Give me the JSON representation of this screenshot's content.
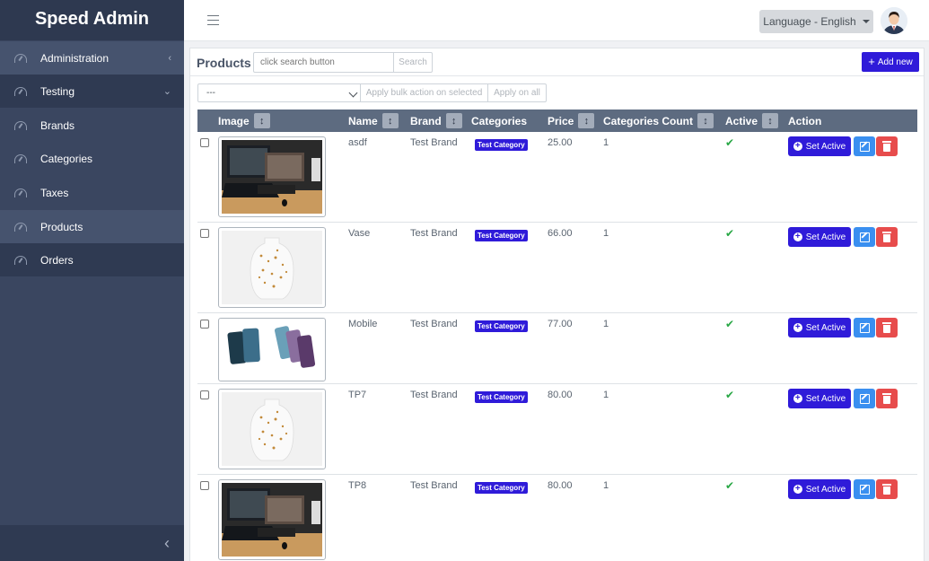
{
  "app": {
    "brand": "Speed Admin"
  },
  "sidebar": {
    "items": [
      {
        "label": "Administration",
        "icon": "dashboard-icon",
        "chevron": "‹"
      },
      {
        "label": "Testing",
        "icon": "dashboard-icon",
        "chevron": "⌄"
      },
      {
        "label": "Brands",
        "icon": "dashboard-icon"
      },
      {
        "label": "Categories",
        "icon": "dashboard-icon"
      },
      {
        "label": "Taxes",
        "icon": "dashboard-icon"
      },
      {
        "label": "Products",
        "icon": "dashboard-icon"
      },
      {
        "label": "Orders",
        "icon": "dashboard-icon"
      }
    ],
    "collapse_glyph": "‹"
  },
  "topbar": {
    "language_label": "Language - English"
  },
  "products": {
    "title": "Products",
    "search_placeholder": "click search button",
    "search_button": "Search",
    "add_button": "Add new",
    "bulk_select_value": "---",
    "bulk_apply": "Apply bulk action on selected",
    "bulk_apply_all": "Apply on all",
    "columns": {
      "image": "Image",
      "name": "Name",
      "brand": "Brand",
      "categories": "Categories",
      "price": "Price",
      "categories_count": "Categories Count",
      "active": "Active",
      "action": "Action"
    },
    "sort_glyph": "↕",
    "set_active_label": "Set Active",
    "active_glyph": "✔",
    "rows": [
      {
        "name": "asdf",
        "brand": "Test Brand",
        "category": "Test Category",
        "price": "25.00",
        "categories_count": "1",
        "image": "laptop-desk-photo"
      },
      {
        "name": "Vase",
        "brand": "Test Brand",
        "category": "Test Category",
        "price": "66.00",
        "categories_count": "1",
        "image": "vase-photo"
      },
      {
        "name": "Mobile",
        "brand": "Test Brand",
        "category": "Test Category",
        "price": "77.00",
        "categories_count": "1",
        "image": "phones-photo"
      },
      {
        "name": "TP7",
        "brand": "Test Brand",
        "category": "Test Category",
        "price": "80.00",
        "categories_count": "1",
        "image": "vase-photo"
      },
      {
        "name": "TP8",
        "brand": "Test Brand",
        "category": "Test Category",
        "price": "80.00",
        "categories_count": "1",
        "image": "laptop-desk-photo"
      }
    ]
  }
}
